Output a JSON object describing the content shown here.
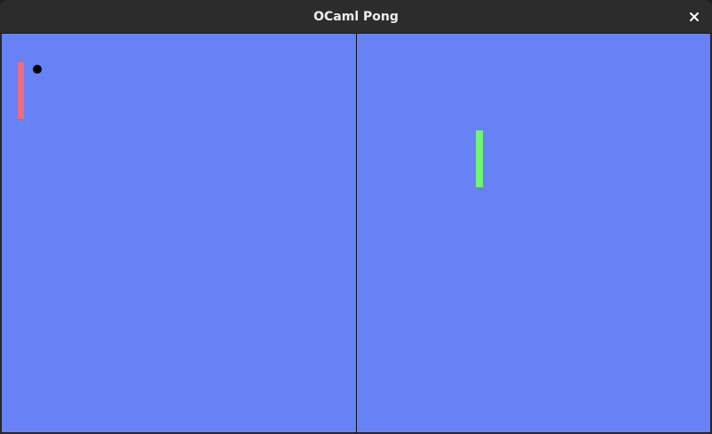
{
  "window": {
    "title": "OCaml Pong",
    "close_icon": "close-icon"
  },
  "colors": {
    "field": "#6682f4",
    "left_paddle": "#f06c84",
    "right_paddle": "#72f672",
    "ball": "#000000",
    "divider": "#111111"
  }
}
